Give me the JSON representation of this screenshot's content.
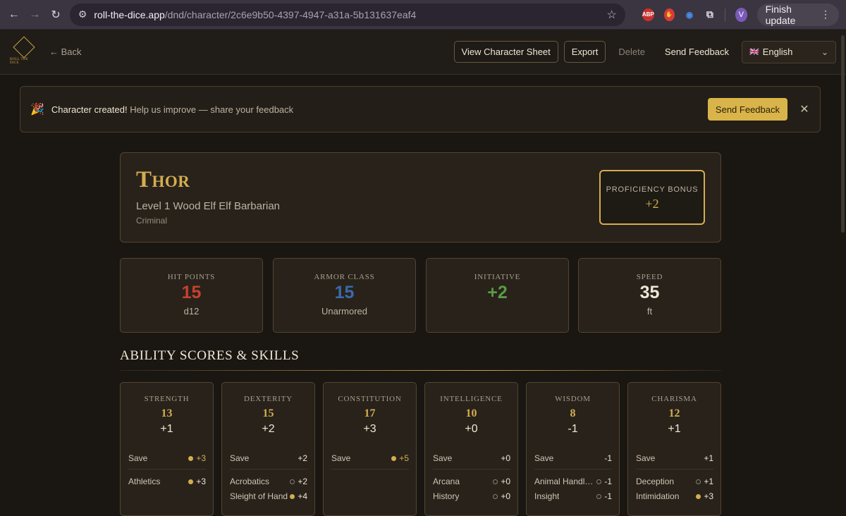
{
  "browser": {
    "url_host": "roll-the-dice.app",
    "url_path": "/dnd/character/2c6e9b50-4397-4947-a31a-5b131637eaf4",
    "avatar_letter": "V",
    "finish_update": "Finish update",
    "ext_abp": "ABP"
  },
  "app": {
    "logo_text": "ROLL THE DICE",
    "back": "← Back",
    "view_sheet": "View Character Sheet",
    "export": "Export",
    "delete": "Delete",
    "send_feedback": "Send Feedback",
    "language": "English",
    "language_flag": "🇬🇧"
  },
  "banner": {
    "icon": "🎉",
    "title": "Character created!",
    "text": " Help us improve — share your feedback",
    "button": "Send Feedback",
    "close": "✕"
  },
  "character": {
    "name": "Thor",
    "subtitle": "Level 1 Wood Elf Elf Barbarian",
    "background": "Criminal",
    "proficiency_label": "PROFICIENCY BONUS",
    "proficiency_value": "+2"
  },
  "stats": [
    {
      "label": "HIT POINTS",
      "value": "15",
      "sub": "d12",
      "color": "#c8402e"
    },
    {
      "label": "ARMOR CLASS",
      "value": "15",
      "sub": "Unarmored",
      "color": "#3a6aa8"
    },
    {
      "label": "INITIATIVE",
      "value": "+2",
      "sub": "",
      "color": "#5a9a46"
    },
    {
      "label": "SPEED",
      "value": "35",
      "sub": "ft",
      "color": "#efe6d4"
    }
  ],
  "section_title": "ABILITY SCORES & SKILLS",
  "abilities": [
    {
      "name": "STRENGTH",
      "score": "13",
      "mod": "+1",
      "save": {
        "label": "Save",
        "value": "+3",
        "prof": true
      },
      "skills": [
        {
          "label": "Athletics",
          "value": "+3",
          "prof": true
        }
      ]
    },
    {
      "name": "DEXTERITY",
      "score": "15",
      "mod": "+2",
      "save": {
        "label": "Save",
        "value": "+2",
        "prof": false
      },
      "skills": [
        {
          "label": "Acrobatics",
          "value": "+2",
          "prof": false
        },
        {
          "label": "Sleight of Hand",
          "value": "+4",
          "prof": true
        }
      ]
    },
    {
      "name": "CONSTITUTION",
      "score": "17",
      "mod": "+3",
      "save": {
        "label": "Save",
        "value": "+5",
        "prof": true
      },
      "skills": []
    },
    {
      "name": "INTELLIGENCE",
      "score": "10",
      "mod": "+0",
      "save": {
        "label": "Save",
        "value": "+0",
        "prof": false
      },
      "skills": [
        {
          "label": "Arcana",
          "value": "+0",
          "prof": false
        },
        {
          "label": "History",
          "value": "+0",
          "prof": false
        }
      ]
    },
    {
      "name": "WISDOM",
      "score": "8",
      "mod": "-1",
      "save": {
        "label": "Save",
        "value": "-1",
        "prof": false
      },
      "skills": [
        {
          "label": "Animal Handling",
          "value": "-1",
          "prof": false
        },
        {
          "label": "Insight",
          "value": "-1",
          "prof": false
        }
      ]
    },
    {
      "name": "CHARISMA",
      "score": "12",
      "mod": "+1",
      "save": {
        "label": "Save",
        "value": "+1",
        "prof": false
      },
      "skills": [
        {
          "label": "Deception",
          "value": "+1",
          "prof": false
        },
        {
          "label": "Intimidation",
          "value": "+3",
          "prof": true
        }
      ]
    }
  ]
}
